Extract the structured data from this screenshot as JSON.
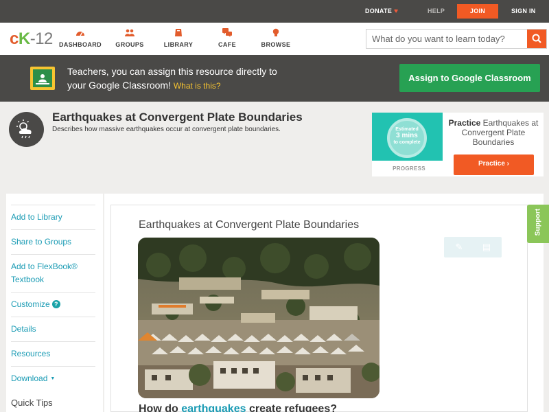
{
  "topbar": {
    "donate": "DONATE",
    "help": "HELP",
    "join": "JOIN",
    "signin": "SIGN IN"
  },
  "logo": {
    "c": "c",
    "k": "K",
    "n": "-12"
  },
  "nav": {
    "dashboard": "DASHBOARD",
    "groups": "GROUPS",
    "library": "LIBRARY",
    "cafe": "CAFE",
    "browse": "BROWSE"
  },
  "search": {
    "placeholder": "What do you want to learn today?"
  },
  "banner": {
    "line1": "Teachers, you can assign this resource directly to",
    "line2": "your Google Classroom!",
    "what": "What is this?",
    "assign": "Assign to Google Classroom"
  },
  "concept": {
    "title": "Earthquakes at Convergent Plate Boundaries",
    "subtitle": "Describes how massive earthquakes occur at convergent plate boundaries."
  },
  "practice": {
    "estimated": "Estimated",
    "mins": "3 mins",
    "complete": "to complete",
    "progress": "PROGRESS",
    "label_bold": "Practice",
    "label_rest": "Earthquakes at Convergent Plate Boundaries",
    "button": "Practice"
  },
  "sidebar": {
    "items": [
      "Add to Library",
      "Share to Groups",
      "Add to FlexBook® Textbook",
      "Customize",
      "Details",
      "Resources",
      "Download"
    ],
    "quick_tips": "Quick Tips"
  },
  "main": {
    "title": "Earthquakes at Convergent Plate Boundaries",
    "question_pre": "How do",
    "question_link": "earthquakes",
    "question_post": "create refugees?"
  },
  "support": "Support",
  "colors": {
    "orange": "#f15a24",
    "green": "#27a153",
    "teal": "#22c2b1",
    "link": "#1a9bb4",
    "dark": "#4a4947"
  }
}
